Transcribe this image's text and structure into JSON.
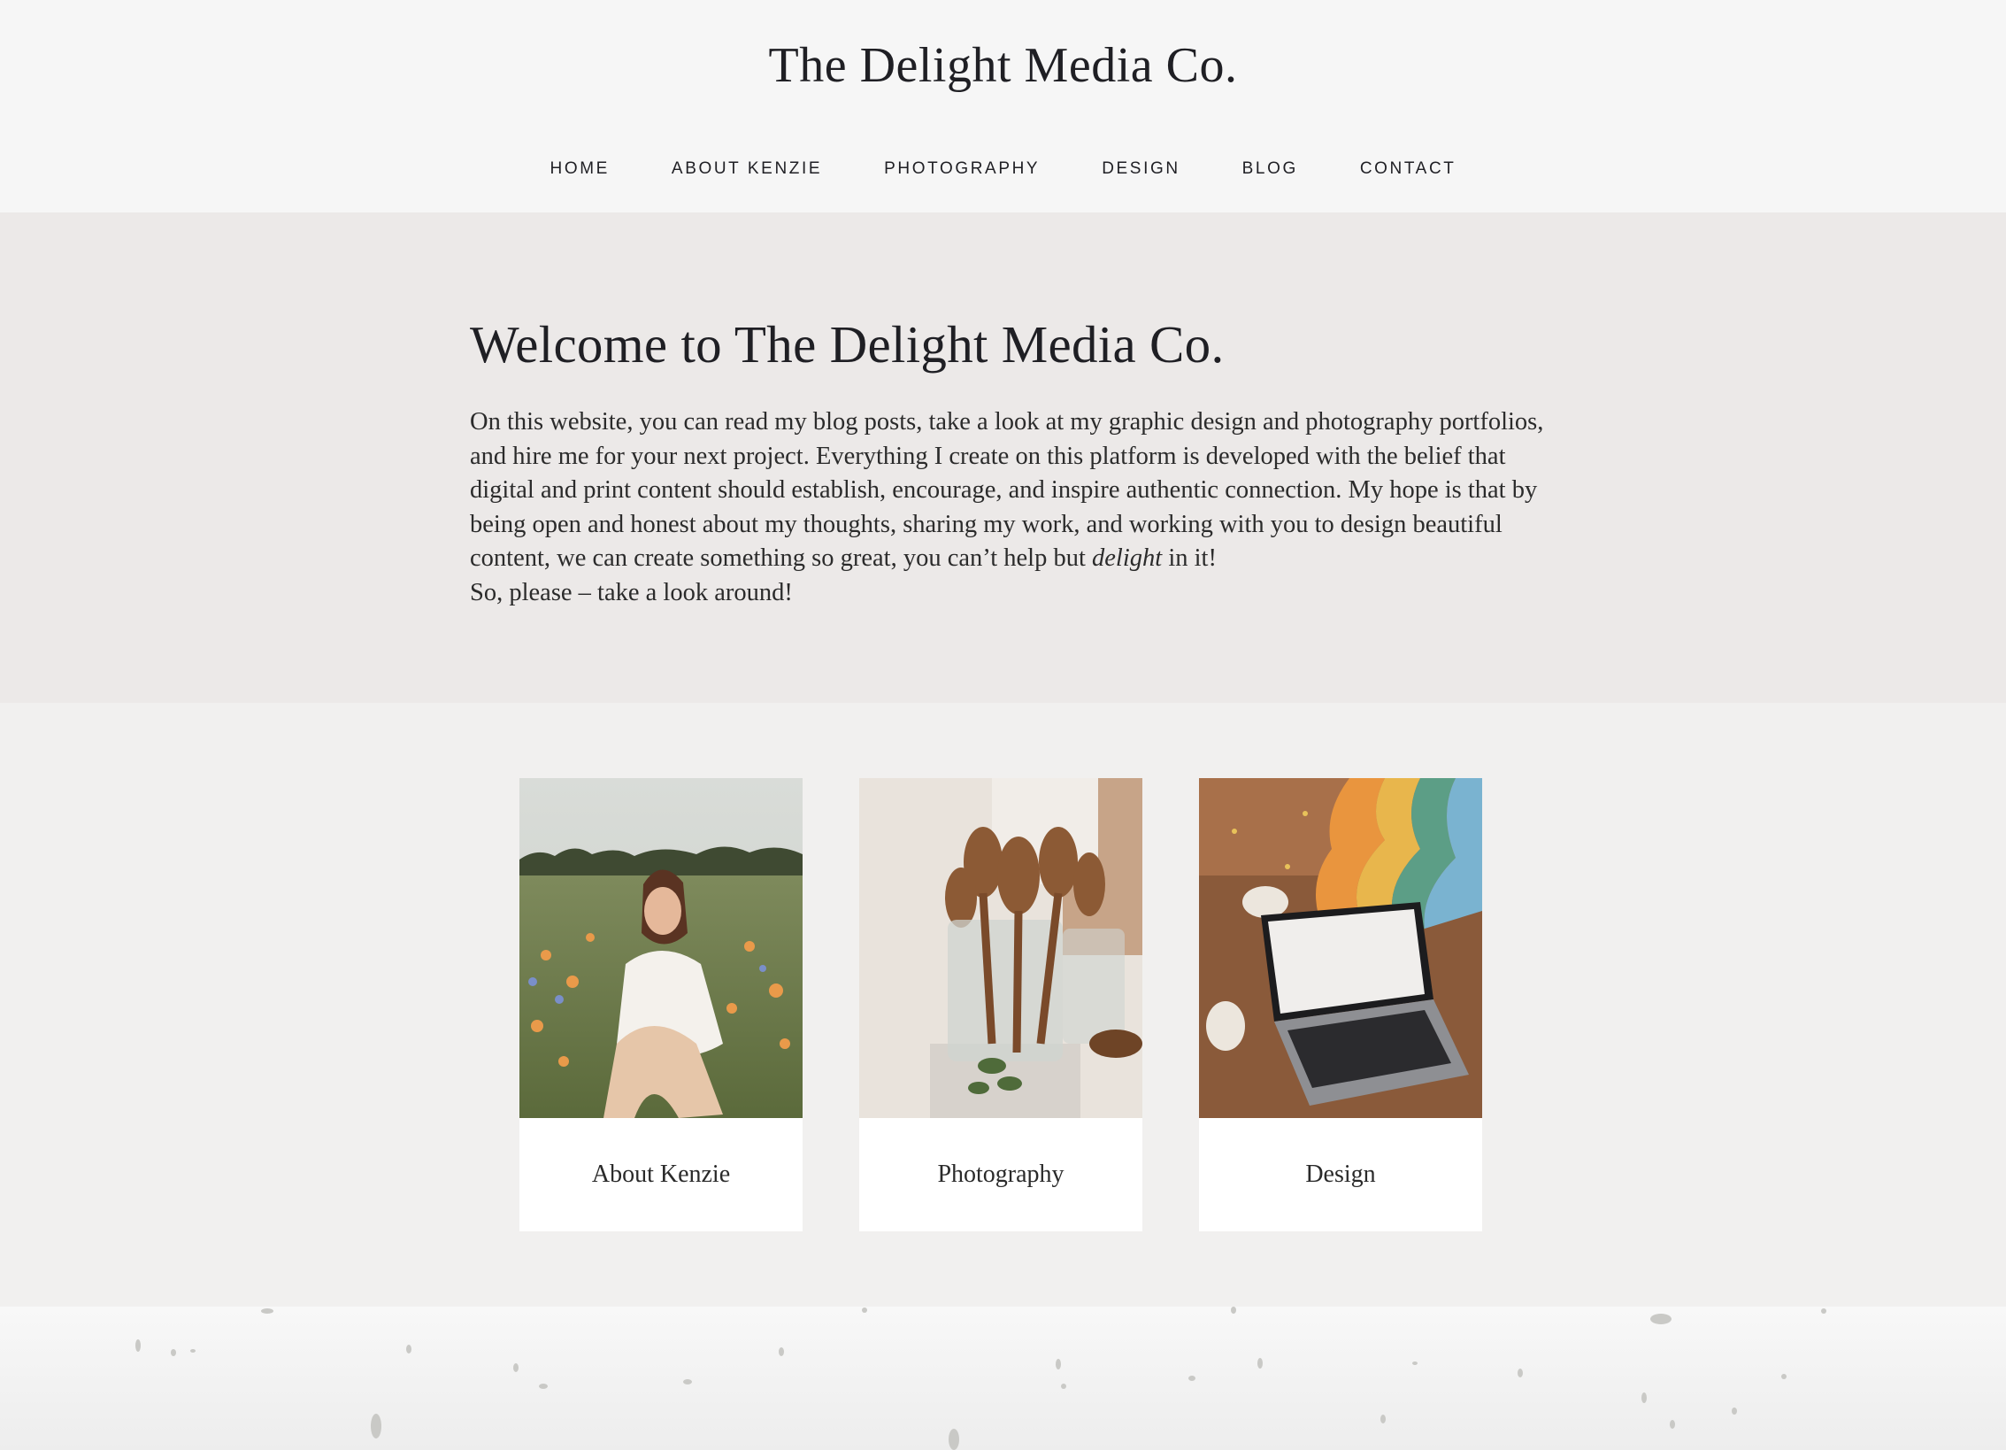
{
  "header": {
    "site_title": "The Delight Media Co."
  },
  "nav": {
    "items": [
      {
        "label": "HOME"
      },
      {
        "label": "ABOUT KENZIE"
      },
      {
        "label": "PHOTOGRAPHY"
      },
      {
        "label": "DESIGN"
      },
      {
        "label": "BLOG"
      },
      {
        "label": "CONTACT"
      }
    ]
  },
  "intro": {
    "heading": "Welcome to The Delight Media Co.",
    "paragraph_before": "On this website, you can read my blog posts, take a look at my graphic design and photography portfolios, and hire me for your next project. Everything I create on this platform is developed with the belief that digital and print content should establish, encourage, and inspire authentic connection. My hope is that by being open and honest about my thoughts, sharing my work, and working with you to design beautiful content, we can create something so great, you can’t help but ",
    "paragraph_emphasis": "delight",
    "paragraph_after": " in it!",
    "closing_line": "So, please – take a look around!"
  },
  "cards": [
    {
      "label": "About Kenzie",
      "image": "portrait-photo"
    },
    {
      "label": "Photography",
      "image": "wooden-spoons-photo"
    },
    {
      "label": "Design",
      "image": "laptop-desk-illustration"
    }
  ],
  "colors": {
    "header_bg": "#f6f6f6",
    "intro_bg": "#ece9e8",
    "page_bg": "#f1f0ef",
    "card_bg": "#ffffff",
    "text": "#1f1f24"
  }
}
